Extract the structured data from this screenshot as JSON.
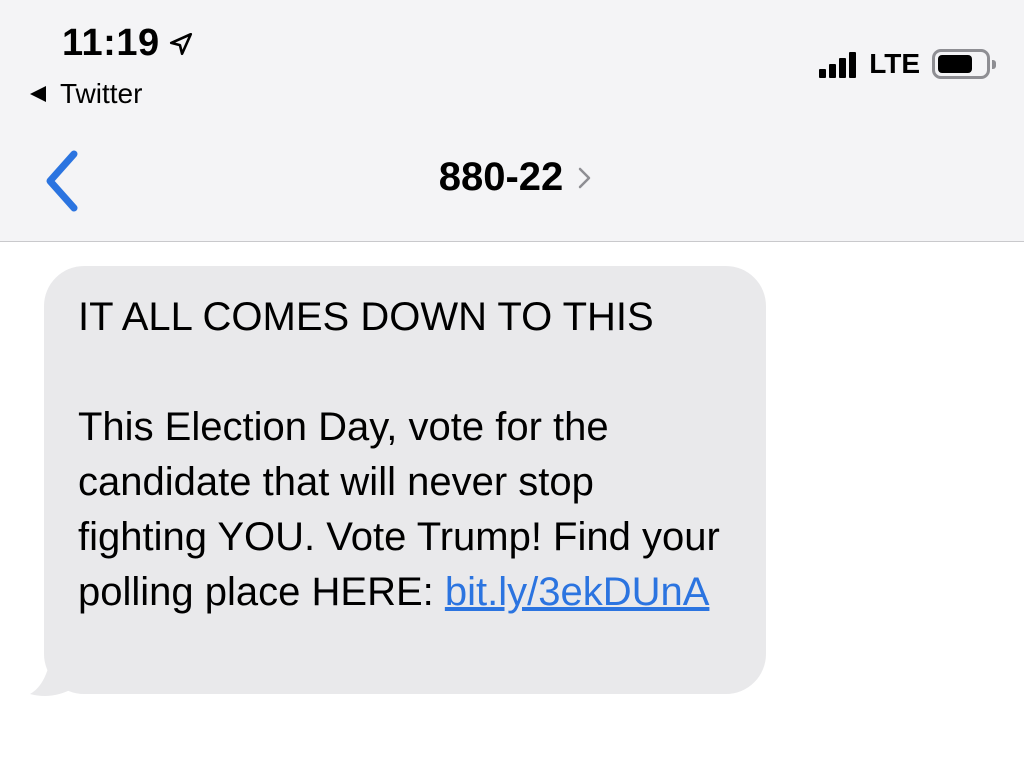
{
  "status_bar": {
    "time": "11:19",
    "location_icon": "location-arrow-icon",
    "back_app": "Twitter",
    "network": "LTE",
    "signal_icon": "cellular-signal-icon",
    "battery_icon": "battery-icon"
  },
  "nav": {
    "back_icon": "chevron-left-icon",
    "contact": "880-22",
    "contact_chevron_icon": "chevron-right-icon"
  },
  "message": {
    "title": "IT ALL COMES DOWN TO THIS",
    "body": "This Election Day, vote for the candidate that will never stop fighting YOU. Vote Trump! Find your polling place HERE: ",
    "link": "bit.ly/3ekDUnA"
  },
  "colors": {
    "accent": "#2b74e0",
    "bubble": "#e9e9eb",
    "header_bg": "#f4f4f6"
  }
}
